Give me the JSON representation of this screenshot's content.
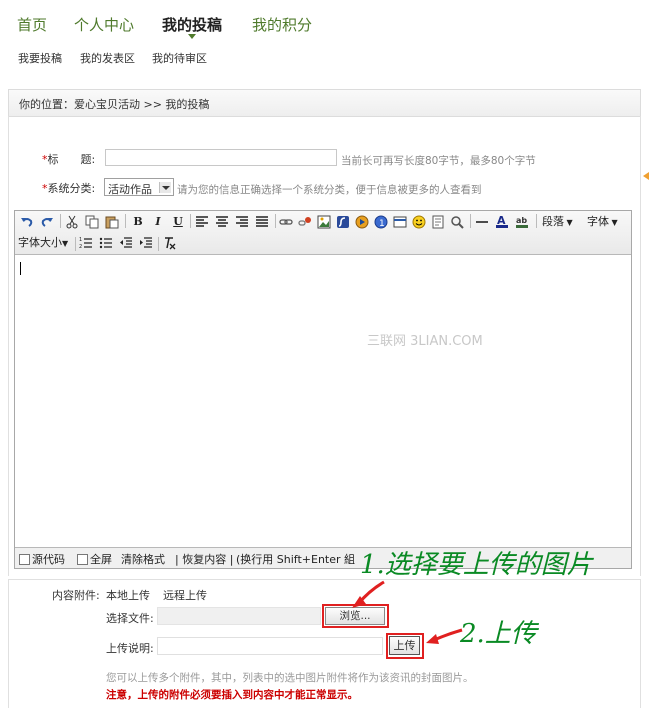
{
  "nav": {
    "tabs": [
      "首页",
      "个人中心",
      "我的投稿",
      "我的积分"
    ],
    "active_tab": "我的投稿",
    "subnav": [
      "我要投稿",
      "我的发表区",
      "我的待审区"
    ]
  },
  "breadcrumb": "你的位置：爱心宝贝活动 >> 我的投稿",
  "form": {
    "title_label": "标　　题:",
    "title_value": "",
    "title_hint": "当前长可再写长度80字节，最多80个字节",
    "category_label": "系统分类:",
    "category_value": "活动作品",
    "category_hint": "请为您的信息正确选择一个系统分类，便于信息被更多的人查看到"
  },
  "editor": {
    "toolbar": {
      "bold": "B",
      "italic": "I",
      "underline": "U",
      "paragraph": "段落",
      "font": "字体",
      "font_size": "字体大小"
    },
    "content": "",
    "watermark": "三联网 3LIAN.COM",
    "footer": {
      "source_code": "源代码",
      "fullscreen": "全屏",
      "clear_format": "清除格式",
      "restore": "| 恢复内容 |",
      "newline_hint": "(换行用 Shift+Enter 組"
    }
  },
  "attachment": {
    "label": "内容附件:",
    "local_upload": "本地上传",
    "remote_upload": "远程上传",
    "choose_file_label": "选择文件:",
    "browse_button": "浏览...",
    "description_label": "上传说明:",
    "description_value": "",
    "upload_button": "上传",
    "note": "您可以上传多个附件，其中，列表中的选中图片附件将作为该资讯的封面图片。",
    "warning": "注意，上传的附件必须要插入到内容中才能正常显示。"
  },
  "annotations": {
    "step1": "1.选择要上传的图片",
    "step2": "2.上传"
  },
  "colors": {
    "nav_green": "#4f7a2c",
    "annotation_green": "#0a8a24",
    "highlight_red": "#e02020",
    "required_star": "#cc0000"
  }
}
